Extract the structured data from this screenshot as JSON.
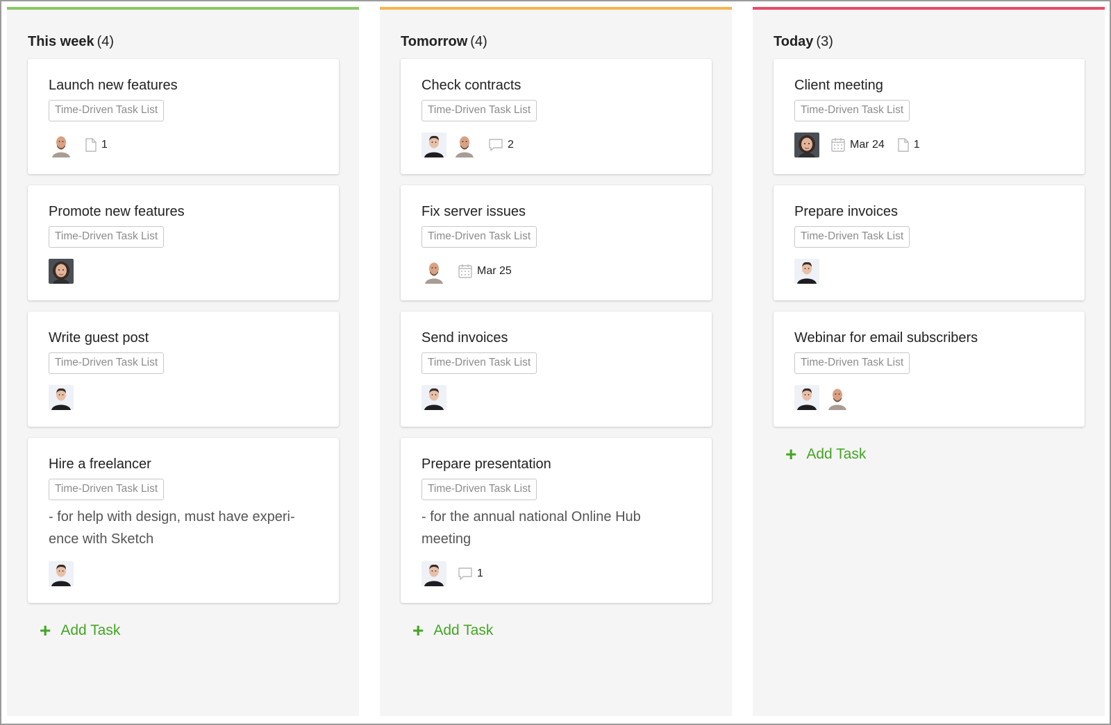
{
  "colors": {
    "this_week": "#8bc767",
    "tomorrow": "#f5b550",
    "today": "#e84b6a",
    "add_task": "#43a523"
  },
  "add_task_label": "Add Task",
  "columns": [
    {
      "title": "This week",
      "count": "(4)",
      "cards": [
        {
          "title": "Launch new features",
          "tag": "Time-Driven Task List",
          "description": "",
          "avatars": [
            "avatar-bald-man"
          ],
          "date": "",
          "comments": "",
          "files": "1"
        },
        {
          "title": "Promote new features",
          "tag": "Time-Driven Task List",
          "description": "",
          "avatars": [
            "avatar-woman"
          ],
          "date": "",
          "comments": "",
          "files": ""
        },
        {
          "title": "Write guest post",
          "tag": "Time-Driven Task List",
          "description": "",
          "avatars": [
            "avatar-man"
          ],
          "date": "",
          "comments": "",
          "files": ""
        },
        {
          "title": "Hire a freelancer",
          "tag": "Time-Driven Task List",
          "description": "- for help with design, must have experi-ence with Sketch",
          "avatars": [
            "avatar-man"
          ],
          "date": "",
          "comments": "",
          "files": ""
        }
      ]
    },
    {
      "title": "Tomorrow",
      "count": "(4)",
      "cards": [
        {
          "title": "Check contracts",
          "tag": "Time-Driven Task List",
          "description": "",
          "avatars": [
            "avatar-man",
            "avatar-bald-man"
          ],
          "date": "",
          "comments": "2",
          "files": ""
        },
        {
          "title": "Fix server issues",
          "tag": "Time-Driven Task List",
          "description": "",
          "avatars": [
            "avatar-bald-man"
          ],
          "date": "Mar 25",
          "comments": "",
          "files": ""
        },
        {
          "title": "Send invoices",
          "tag": "Time-Driven Task List",
          "description": "",
          "avatars": [
            "avatar-man"
          ],
          "date": "",
          "comments": "",
          "files": ""
        },
        {
          "title": "Prepare presentation",
          "tag": "Time-Driven Task List",
          "description": "- for the annual national Online Hub meeting",
          "avatars": [
            "avatar-man"
          ],
          "date": "",
          "comments": "1",
          "files": ""
        }
      ]
    },
    {
      "title": "Today",
      "count": "(3)",
      "cards": [
        {
          "title": "Client meeting",
          "tag": "Time-Driven Task List",
          "description": "",
          "avatars": [
            "avatar-woman"
          ],
          "date": "Mar 24",
          "comments": "",
          "files": "1"
        },
        {
          "title": "Prepare invoices",
          "tag": "Time-Driven Task List",
          "description": "",
          "avatars": [
            "avatar-man"
          ],
          "date": "",
          "comments": "",
          "files": ""
        },
        {
          "title": "Webinar for email subscribers",
          "tag": "Time-Driven Task List",
          "description": "",
          "avatars": [
            "avatar-man",
            "avatar-bald-man"
          ],
          "date": "",
          "comments": "",
          "files": ""
        }
      ]
    }
  ]
}
